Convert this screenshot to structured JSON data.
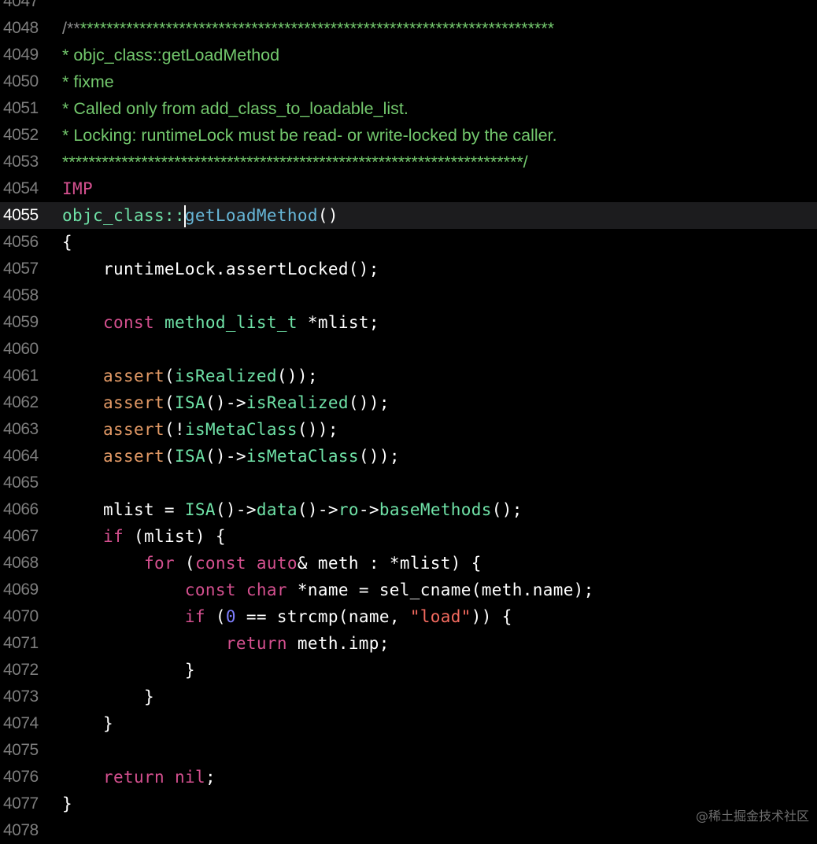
{
  "colors": {
    "background": "#000000",
    "current_line": "#1c1c1e",
    "line_number": "#7d7d7d",
    "line_number_current": "#ffffff",
    "comment": "#73c86d",
    "plain": "#ffffff",
    "keyword": "#d4508f",
    "type": "#6fe2a7",
    "macro": "#e39a66",
    "function": "#6fe2a7",
    "declaration": "#67b7d8",
    "string": "#f36a5f",
    "number": "#7f7fff"
  },
  "editor": {
    "current_line": "4055",
    "lines": [
      {
        "num": "4047",
        "tokens": []
      },
      {
        "num": "4048",
        "comment": true,
        "tokens": [
          {
            "t": "/**",
            "c": "#8a8a8a"
          },
          {
            "t": "************************************************************************",
            "c": "#73c86d"
          }
        ]
      },
      {
        "num": "4049",
        "comment": true,
        "tokens": [
          {
            "t": "* objc_class::getLoadMethod",
            "c": "#73c86d"
          }
        ]
      },
      {
        "num": "4050",
        "comment": true,
        "tokens": [
          {
            "t": "* fixme",
            "c": "#73c86d"
          }
        ]
      },
      {
        "num": "4051",
        "comment": true,
        "tokens": [
          {
            "t": "* Called only from add_class_to_loadable_list.",
            "c": "#73c86d"
          }
        ]
      },
      {
        "num": "4052",
        "comment": true,
        "tokens": [
          {
            "t": "* Locking: runtimeLock must be read- or write-locked by the caller.",
            "c": "#73c86d"
          }
        ]
      },
      {
        "num": "4053",
        "comment": true,
        "tokens": [
          {
            "t": "**********************************************************************/",
            "c": "#73c86d"
          }
        ]
      },
      {
        "num": "4054",
        "tokens": [
          {
            "t": "IMP",
            "c": "#d4508f"
          }
        ]
      },
      {
        "num": "4055",
        "tokens": [
          {
            "t": "objc_class::",
            "c": "#6fe2a7"
          },
          {
            "caret": true
          },
          {
            "t": "getLoadMethod",
            "c": "#67b7d8"
          },
          {
            "t": "()",
            "c": "#ffffff"
          }
        ]
      },
      {
        "num": "4056",
        "tokens": [
          {
            "t": "{",
            "c": "#ffffff"
          }
        ]
      },
      {
        "num": "4057",
        "tokens": [
          {
            "t": "    runtimeLock.assertLocked();",
            "c": "#ffffff"
          }
        ]
      },
      {
        "num": "4058",
        "tokens": []
      },
      {
        "num": "4059",
        "tokens": [
          {
            "t": "    ",
            "c": "#ffffff"
          },
          {
            "t": "const",
            "c": "#d4508f"
          },
          {
            "t": " ",
            "c": "#ffffff"
          },
          {
            "t": "method_list_t",
            "c": "#6fe2a7"
          },
          {
            "t": " *mlist;",
            "c": "#ffffff"
          }
        ]
      },
      {
        "num": "4060",
        "tokens": []
      },
      {
        "num": "4061",
        "tokens": [
          {
            "t": "    ",
            "c": "#ffffff"
          },
          {
            "t": "assert",
            "c": "#e39a66"
          },
          {
            "t": "(",
            "c": "#ffffff"
          },
          {
            "t": "isRealized",
            "c": "#6fe2a7"
          },
          {
            "t": "());",
            "c": "#ffffff"
          }
        ]
      },
      {
        "num": "4062",
        "tokens": [
          {
            "t": "    ",
            "c": "#ffffff"
          },
          {
            "t": "assert",
            "c": "#e39a66"
          },
          {
            "t": "(",
            "c": "#ffffff"
          },
          {
            "t": "ISA",
            "c": "#6fe2a7"
          },
          {
            "t": "()->",
            "c": "#ffffff"
          },
          {
            "t": "isRealized",
            "c": "#6fe2a7"
          },
          {
            "t": "());",
            "c": "#ffffff"
          }
        ]
      },
      {
        "num": "4063",
        "tokens": [
          {
            "t": "    ",
            "c": "#ffffff"
          },
          {
            "t": "assert",
            "c": "#e39a66"
          },
          {
            "t": "(!",
            "c": "#ffffff"
          },
          {
            "t": "isMetaClass",
            "c": "#6fe2a7"
          },
          {
            "t": "());",
            "c": "#ffffff"
          }
        ]
      },
      {
        "num": "4064",
        "tokens": [
          {
            "t": "    ",
            "c": "#ffffff"
          },
          {
            "t": "assert",
            "c": "#e39a66"
          },
          {
            "t": "(",
            "c": "#ffffff"
          },
          {
            "t": "ISA",
            "c": "#6fe2a7"
          },
          {
            "t": "()->",
            "c": "#ffffff"
          },
          {
            "t": "isMetaClass",
            "c": "#6fe2a7"
          },
          {
            "t": "());",
            "c": "#ffffff"
          }
        ]
      },
      {
        "num": "4065",
        "tokens": []
      },
      {
        "num": "4066",
        "tokens": [
          {
            "t": "    mlist = ",
            "c": "#ffffff"
          },
          {
            "t": "ISA",
            "c": "#6fe2a7"
          },
          {
            "t": "()->",
            "c": "#ffffff"
          },
          {
            "t": "data",
            "c": "#6fe2a7"
          },
          {
            "t": "()->",
            "c": "#ffffff"
          },
          {
            "t": "ro",
            "c": "#6fe2a7"
          },
          {
            "t": "->",
            "c": "#ffffff"
          },
          {
            "t": "baseMethods",
            "c": "#6fe2a7"
          },
          {
            "t": "();",
            "c": "#ffffff"
          }
        ]
      },
      {
        "num": "4067",
        "tokens": [
          {
            "t": "    ",
            "c": "#ffffff"
          },
          {
            "t": "if",
            "c": "#d4508f"
          },
          {
            "t": " (mlist) {",
            "c": "#ffffff"
          }
        ]
      },
      {
        "num": "4068",
        "tokens": [
          {
            "t": "        ",
            "c": "#ffffff"
          },
          {
            "t": "for",
            "c": "#d4508f"
          },
          {
            "t": " (",
            "c": "#ffffff"
          },
          {
            "t": "const",
            "c": "#d4508f"
          },
          {
            "t": " ",
            "c": "#ffffff"
          },
          {
            "t": "auto",
            "c": "#d4508f"
          },
          {
            "t": "& meth : *mlist) {",
            "c": "#ffffff"
          }
        ]
      },
      {
        "num": "4069",
        "tokens": [
          {
            "t": "            ",
            "c": "#ffffff"
          },
          {
            "t": "const",
            "c": "#d4508f"
          },
          {
            "t": " ",
            "c": "#ffffff"
          },
          {
            "t": "char",
            "c": "#d4508f"
          },
          {
            "t": " *name = sel_cname(meth.name);",
            "c": "#ffffff"
          }
        ]
      },
      {
        "num": "4070",
        "tokens": [
          {
            "t": "            ",
            "c": "#ffffff"
          },
          {
            "t": "if",
            "c": "#d4508f"
          },
          {
            "t": " (",
            "c": "#ffffff"
          },
          {
            "t": "0",
            "c": "#7f7fff"
          },
          {
            "t": " == strcmp(name, ",
            "c": "#ffffff"
          },
          {
            "t": "\"load\"",
            "c": "#f36a5f"
          },
          {
            "t": ")) {",
            "c": "#ffffff"
          }
        ]
      },
      {
        "num": "4071",
        "tokens": [
          {
            "t": "                ",
            "c": "#ffffff"
          },
          {
            "t": "return",
            "c": "#d4508f"
          },
          {
            "t": " meth.imp;",
            "c": "#ffffff"
          }
        ]
      },
      {
        "num": "4072",
        "tokens": [
          {
            "t": "            }",
            "c": "#ffffff"
          }
        ]
      },
      {
        "num": "4073",
        "tokens": [
          {
            "t": "        }",
            "c": "#ffffff"
          }
        ]
      },
      {
        "num": "4074",
        "tokens": [
          {
            "t": "    }",
            "c": "#ffffff"
          }
        ]
      },
      {
        "num": "4075",
        "tokens": []
      },
      {
        "num": "4076",
        "tokens": [
          {
            "t": "    ",
            "c": "#ffffff"
          },
          {
            "t": "return",
            "c": "#d4508f"
          },
          {
            "t": " ",
            "c": "#ffffff"
          },
          {
            "t": "nil",
            "c": "#d4508f"
          },
          {
            "t": ";",
            "c": "#ffffff"
          }
        ]
      },
      {
        "num": "4077",
        "tokens": [
          {
            "t": "}",
            "c": "#ffffff"
          }
        ]
      },
      {
        "num": "4078",
        "tokens": []
      }
    ]
  },
  "watermark": "@稀土掘金技术社区"
}
